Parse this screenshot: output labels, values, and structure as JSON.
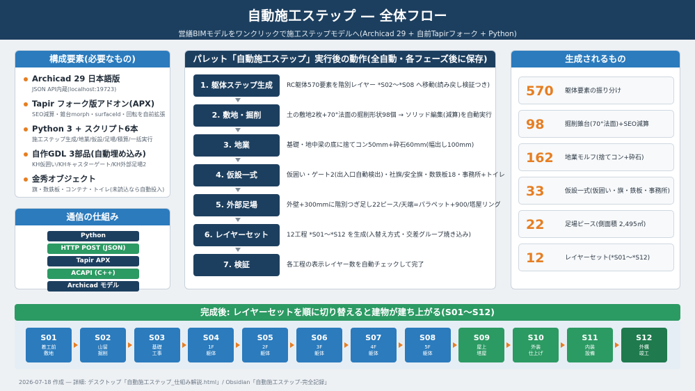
{
  "header": {
    "title": "自動施工ステップ ― 全体フロー",
    "subtitle": "営繕BIMモデルをワンクリックで施工ステップモデルへ(Archicad 29 + 自前Tapirフォーク + Python)"
  },
  "components": {
    "title": "構成要素(必要なもの)",
    "items": [
      {
        "name": "Archicad 29 日本語版",
        "desc": "JSON API内蔵(localhost:19723)"
      },
      {
        "name": "Tapir フォーク版アドオン(APX)",
        "desc": "SEO減算・錐台morph・surfaceId・回転を自前拡張"
      },
      {
        "name": "Python 3 + スクリプト6本",
        "desc": "施工ステップ生成/地業/仮設/足場/積算/一括実行"
      },
      {
        "name": "自作GDL 3部品(自動埋め込み)",
        "desc": "KH仮囲い/KHキャスターゲート/KH外部足場2"
      },
      {
        "name": "金秀オブジェクト",
        "desc": "旗・数鉄板・コンテナ・トイレ(未読込なら自動投入)"
      }
    ]
  },
  "comms": {
    "title": "通信の仕組み",
    "stack": [
      "Python",
      "HTTP POST (JSON)",
      "Tapir APX",
      "ACAPI (C++)",
      "Archicad モデル"
    ]
  },
  "actions": {
    "title": "パレット「自動施工ステップ」実行後の動作(全自動・各フェーズ後に保存)",
    "steps": [
      {
        "label": "1. 躯体ステップ生成",
        "desc": "RC躯体570要素を階別レイヤー *S02〜*S08 へ移動(読み戻し検証つき)"
      },
      {
        "label": "2. 敷地・掘削",
        "desc": "土の敷地2枚+70°法面の掘削形状98個 → ソリッド編集(減算)を自動実行"
      },
      {
        "label": "3. 地業",
        "desc": "基礎・地中梁の底に捨てコン50mm+砕石60mm(幅出し100mm)"
      },
      {
        "label": "4. 仮設一式",
        "desc": "仮囲い・ゲート2(出入口自動検出)・社旗/安全旗・数鉄板18・事務所+トイレ"
      },
      {
        "label": "5. 外部足場",
        "desc": "外壁+300mmに階別つぎ足し22ピース/天端=パラペット+900/塔屋リング"
      },
      {
        "label": "6. レイヤーセット",
        "desc": "12工程 *S01〜*S12 を生成(入替え方式・交差グループ焼き込み)"
      },
      {
        "label": "7. 検証",
        "desc": "各工程の表示レイヤー数を自動チェックして完了"
      }
    ]
  },
  "results": {
    "title": "生成されるもの",
    "items": [
      {
        "num": "570",
        "label": "躯体要素の振り分け"
      },
      {
        "num": "98",
        "label": "掘削錐台(70°法面)+SEO減算"
      },
      {
        "num": "162",
        "label": "地業モルフ(捨てコン+砕石)"
      },
      {
        "num": "33",
        "label": "仮設一式(仮囲い・旗・鉄板・事務所)"
      },
      {
        "num": "22",
        "label": "足場ピース(側面積 2,495㎡)"
      },
      {
        "num": "12",
        "label": "レイヤーセット(*S01〜*S12)"
      }
    ]
  },
  "sequence": {
    "title": "完成後: レイヤーセットを順に切り替えると建物が建ち上がる(S01〜S12)",
    "items": [
      {
        "code": "S01",
        "sub": "着工前\n敷地",
        "color": "#2b7bbd"
      },
      {
        "code": "S02",
        "sub": "山留\n掘削",
        "color": "#2b7bbd"
      },
      {
        "code": "S03",
        "sub": "基礎\n工事",
        "color": "#2b7bbd"
      },
      {
        "code": "S04",
        "sub": "1F\n躯体",
        "color": "#2b7bbd"
      },
      {
        "code": "S05",
        "sub": "2F\n躯体",
        "color": "#2b7bbd"
      },
      {
        "code": "S06",
        "sub": "3F\n躯体",
        "color": "#2b7bbd"
      },
      {
        "code": "S07",
        "sub": "4F\n躯体",
        "color": "#2b7bbd"
      },
      {
        "code": "S08",
        "sub": "5F\n躯体",
        "color": "#2b7bbd"
      },
      {
        "code": "S09",
        "sub": "屋上\n塔屋",
        "color": "#2c9a63"
      },
      {
        "code": "S10",
        "sub": "外装\n仕上げ",
        "color": "#2c9a63"
      },
      {
        "code": "S11",
        "sub": "内装\n設備",
        "color": "#2c9a63"
      },
      {
        "code": "S12",
        "sub": "外構\n竣工",
        "color": "#1f7a4d"
      }
    ]
  },
  "footer": "2026-07-18 作成 ― 詳細: デスクトップ「自動施工ステップ_仕組み解説.html」/ Obsidian「自動施工ステップ-完全記録」"
}
